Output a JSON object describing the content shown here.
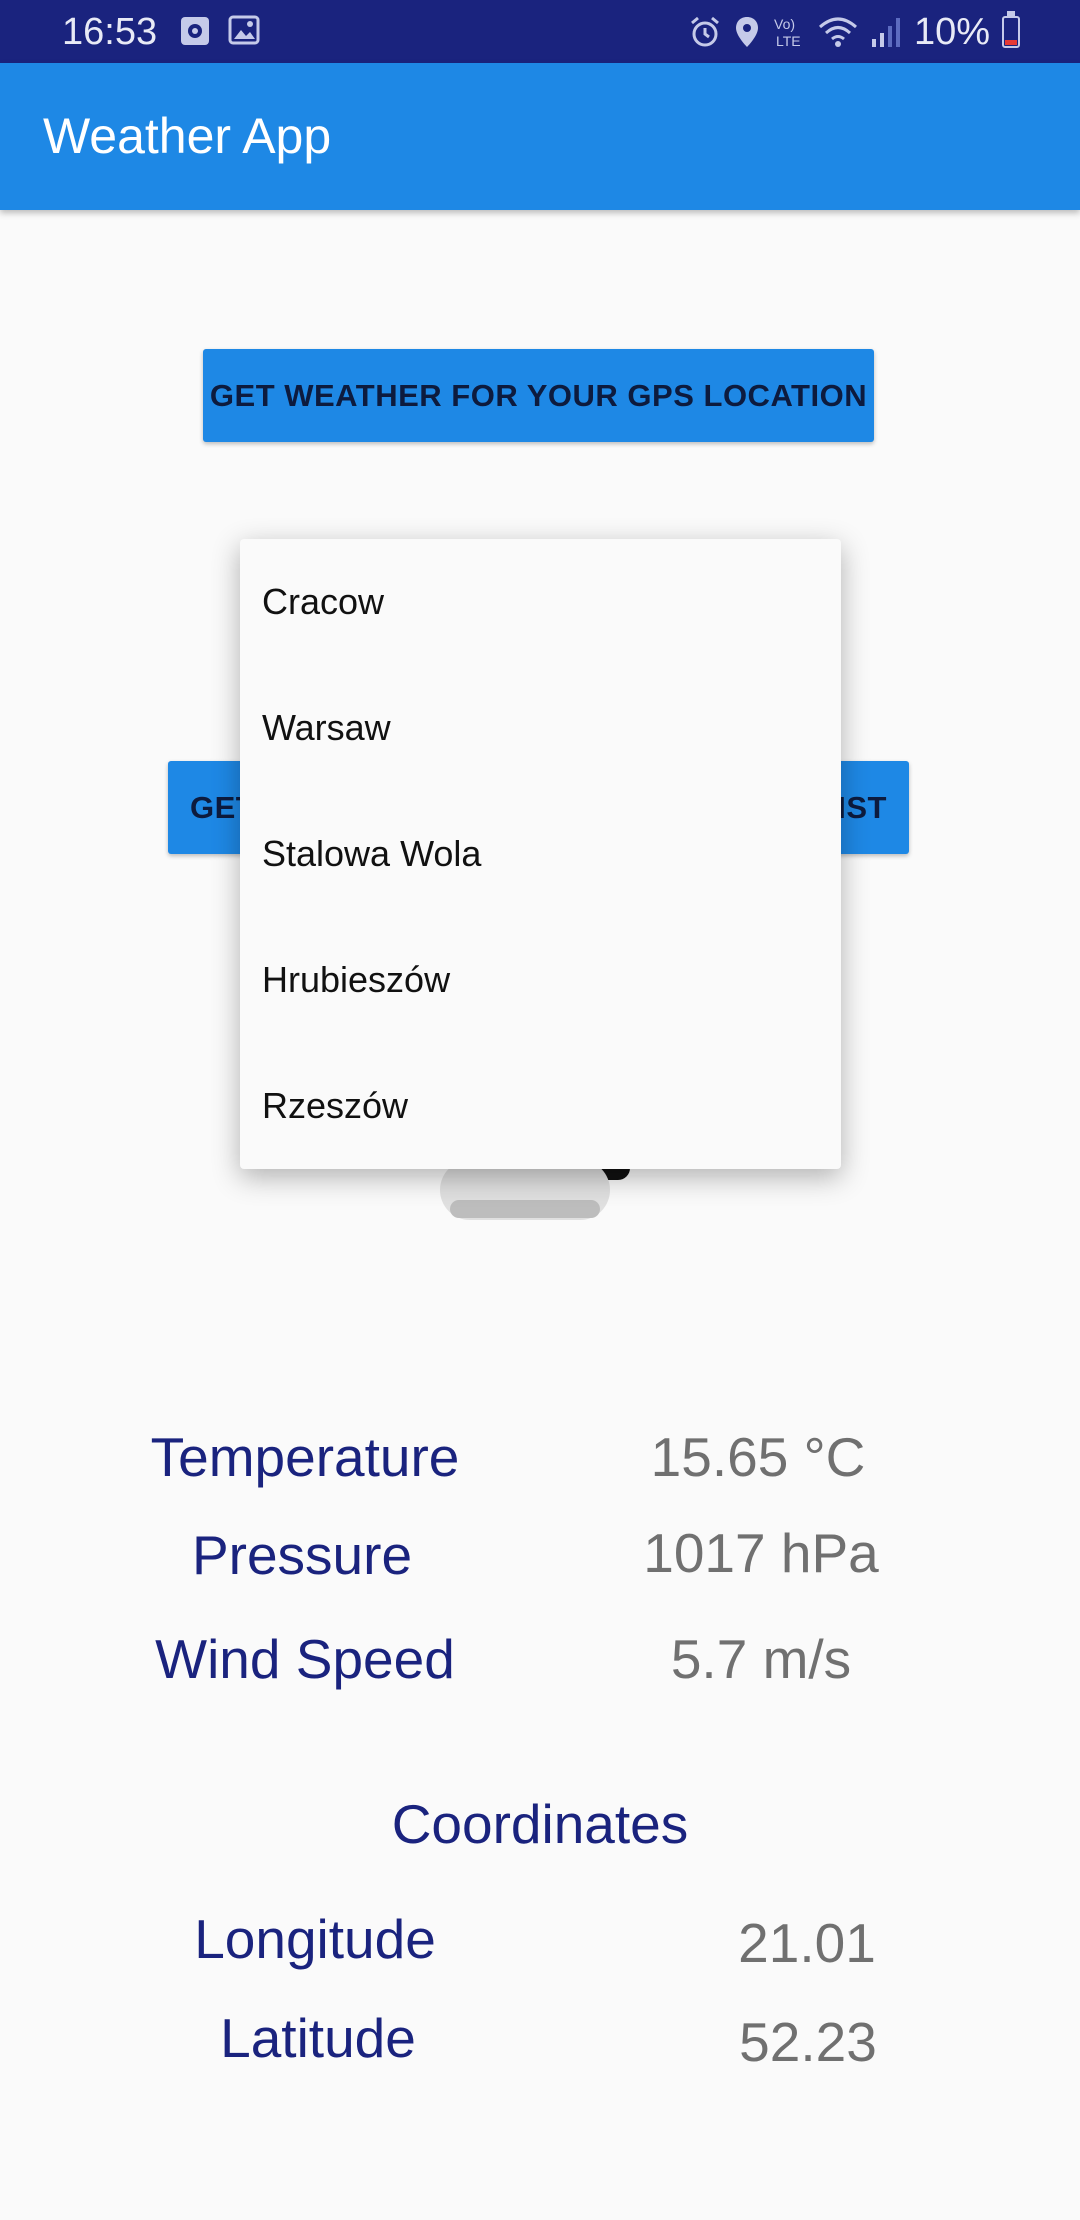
{
  "status_bar": {
    "time": "16:53",
    "battery": "10%",
    "icons": [
      "timer-icon",
      "gallery-icon",
      "alarm-icon",
      "location-icon",
      "volte-icon",
      "wifi-icon",
      "signal-icon",
      "battery-icon"
    ],
    "volte_text": "Vo)\nLTE"
  },
  "app_bar": {
    "title": "Weather App"
  },
  "buttons": {
    "gps": "GET WEATHER FOR YOUR GPS LOCATION",
    "list_left": "GET",
    "list_right": "IST"
  },
  "dropdown": {
    "items": [
      "Cracow",
      "Warsaw",
      "Stalowa Wola",
      "Hrubieszów",
      "Rzeszów"
    ]
  },
  "weather": {
    "temperature_label": "Temperature",
    "temperature_value": "15.65 °C",
    "pressure_label": "Pressure",
    "pressure_value": "1017 hPa",
    "wind_label": "Wind Speed",
    "wind_value": "5.7 m/s"
  },
  "coordinates": {
    "heading": "Coordinates",
    "longitude_label": "Longitude",
    "longitude_value": "21.01",
    "latitude_label": "Latitude",
    "latitude_value": "52.23"
  },
  "colors": {
    "status_bar": "#1a237e",
    "app_bar": "#1e88e5",
    "label_text": "#1a237e",
    "value_text": "#707070"
  }
}
